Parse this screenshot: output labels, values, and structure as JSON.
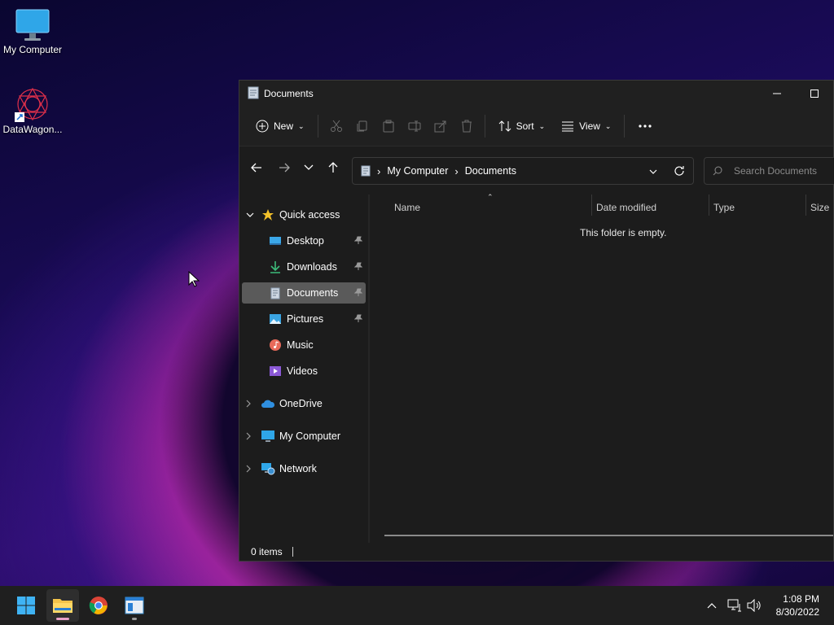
{
  "desktop": {
    "icons": [
      {
        "label": "My Computer",
        "icon": "monitor-icon"
      },
      {
        "label": "DataWagon...",
        "icon": "datawagon-shortcut-icon"
      }
    ]
  },
  "window": {
    "title": "Documents",
    "toolbar": {
      "new_label": "New",
      "sort_label": "Sort",
      "view_label": "View",
      "more_label": "..."
    },
    "address": {
      "crumbs": [
        "My Computer",
        "Documents"
      ]
    },
    "search": {
      "placeholder": "Search Documents"
    },
    "sidebar": {
      "quick_access": "Quick access",
      "items": [
        {
          "label": "Desktop",
          "pinned": true
        },
        {
          "label": "Downloads",
          "pinned": true
        },
        {
          "label": "Documents",
          "pinned": true,
          "selected": true
        },
        {
          "label": "Pictures",
          "pinned": true
        },
        {
          "label": "Music",
          "pinned": false
        },
        {
          "label": "Videos",
          "pinned": false
        }
      ],
      "roots": [
        "OneDrive",
        "My Computer",
        "Network"
      ]
    },
    "columns": [
      "Name",
      "Date modified",
      "Type",
      "Size"
    ],
    "empty_message": "This folder is empty.",
    "status": "0 items"
  },
  "taskbar": {
    "apps": [
      "start-icon",
      "file-explorer-icon",
      "chrome-icon",
      "app-window-icon"
    ],
    "time": "1:08 PM",
    "date": "8/30/2022"
  }
}
